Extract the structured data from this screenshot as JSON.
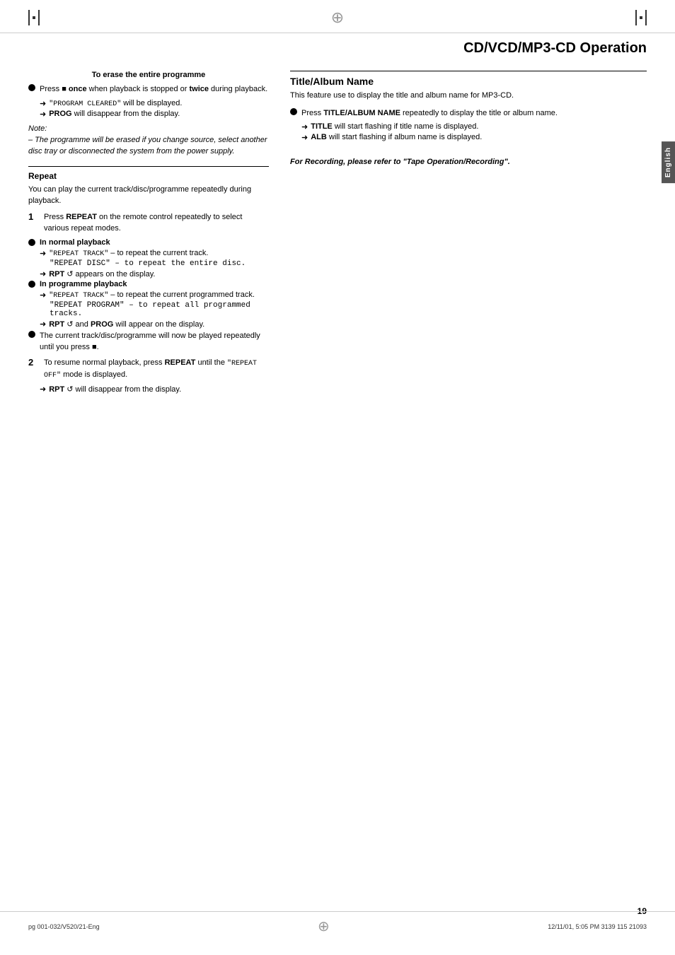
{
  "page": {
    "title": "CD/VCD/MP3-CD Operation",
    "page_number": "19",
    "footer_left": "pg 001-032/V520/21-Eng",
    "footer_center": "19",
    "footer_right": "12/11/01, 5:05 PM  3139 115 21093"
  },
  "erase_section": {
    "title": "To erase the entire programme",
    "bullet1": "Press ",
    "bullet1_bold": "■ once",
    "bullet1_rest": " when playback is stopped or ",
    "bullet1_bold2": "twice",
    "bullet1_rest2": " during playback.",
    "arrow1": "\"PROGRAM CLEARED\" will be displayed.",
    "arrow1_bold": "PROG",
    "arrow1_rest": " will disappear from the display.",
    "note_label": "Note:",
    "note_text": "– The programme will be erased if you change source, select another disc tray or disconnected the system from the power supply."
  },
  "repeat_section": {
    "title": "Repeat",
    "intro": "You can play the current track/disc/programme repeatedly during playback.",
    "item1_num": "1",
    "item1_text": "Press ",
    "item1_bold": "REPEAT",
    "item1_rest": " on the remote control repeatedly to select various repeat modes.",
    "normal_playback_title": "In normal playback",
    "normal_arrow1": "\"REPEAT TRACK\" – to repeat the current track.",
    "normal_arrow1a": "\"REPEAT DISC\" – to repeat the entire disc.",
    "normal_arrow2_bold": "RPT",
    "normal_arrow2_rest": " ↺ appears on the display.",
    "prog_playback_title": "In programme playback",
    "prog_arrow1": "\"REPEAT TRACK\" – to repeat the current programmed track.",
    "prog_arrow1a": "\"REPEAT PROGRAM\" – to repeat all programmed tracks.",
    "prog_arrow2_bold": "RPT",
    "prog_arrow2_rest": " ↺ and ",
    "prog_arrow2_bold2": "PROG",
    "prog_arrow2_rest2": " will appear on the display.",
    "bullet_repeat": "The current track/disc/programme will now be played repeatedly until you press ■.",
    "item2_num": "2",
    "item2_text": "To resume normal playback, press ",
    "item2_bold": "REPEAT",
    "item2_rest": " until the \"REPEAT OFF\" mode is displayed.",
    "item2_arrow_bold": "RPT",
    "item2_arrow_rest": " ↺ will disappear from the display."
  },
  "title_album_section": {
    "title": "Title/Album Name",
    "intro": "This feature use to display the title and album name for MP3-CD.",
    "bullet_text": "Press ",
    "bullet_bold": "TITLE/ALBUM NAME",
    "bullet_rest": " repeatedly to display the title or album name.",
    "arrow1_bold": "TITLE",
    "arrow1_rest": " will start flashing if title name is displayed.",
    "arrow2_bold": "ALB",
    "arrow2_rest": " will start flashing if album name is displayed.",
    "recording_note": "For Recording, please refer to \"Tape Operation/Recording\"."
  },
  "english_tab": "English"
}
